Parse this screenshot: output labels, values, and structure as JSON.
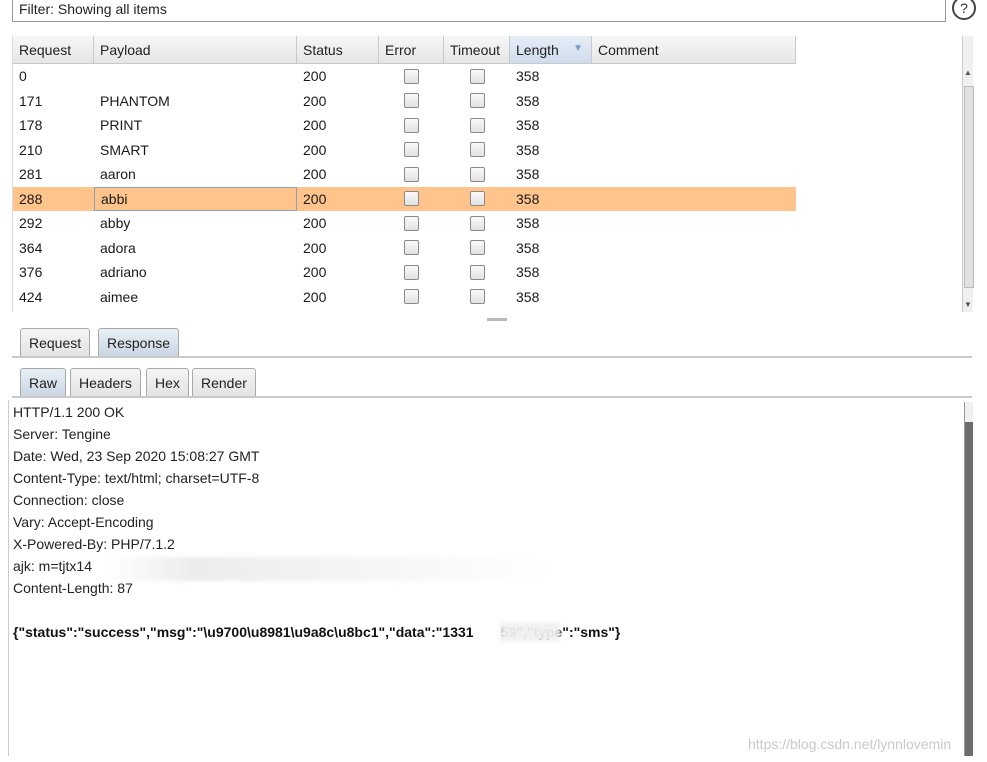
{
  "filter": {
    "text": "Filter: Showing all items",
    "help_label": "?"
  },
  "table": {
    "columns": [
      "Request",
      "Payload",
      "Status",
      "Error",
      "Timeout",
      "Length",
      "Comment"
    ],
    "rows": [
      {
        "request": "0",
        "payload": "",
        "status": "200",
        "error": false,
        "timeout": false,
        "length": "358",
        "comment": ""
      },
      {
        "request": "171",
        "payload": "PHANTOM",
        "status": "200",
        "error": false,
        "timeout": false,
        "length": "358",
        "comment": ""
      },
      {
        "request": "178",
        "payload": "PRINT",
        "status": "200",
        "error": false,
        "timeout": false,
        "length": "358",
        "comment": ""
      },
      {
        "request": "210",
        "payload": "SMART",
        "status": "200",
        "error": false,
        "timeout": false,
        "length": "358",
        "comment": ""
      },
      {
        "request": "281",
        "payload": "aaron",
        "status": "200",
        "error": false,
        "timeout": false,
        "length": "358",
        "comment": ""
      },
      {
        "request": "288",
        "payload": "abbi",
        "status": "200",
        "error": false,
        "timeout": false,
        "length": "358",
        "comment": "",
        "selected": true
      },
      {
        "request": "292",
        "payload": "abby",
        "status": "200",
        "error": false,
        "timeout": false,
        "length": "358",
        "comment": ""
      },
      {
        "request": "364",
        "payload": "adora",
        "status": "200",
        "error": false,
        "timeout": false,
        "length": "358",
        "comment": ""
      },
      {
        "request": "376",
        "payload": "adriano",
        "status": "200",
        "error": false,
        "timeout": false,
        "length": "358",
        "comment": ""
      },
      {
        "request": "424",
        "payload": "aimee",
        "status": "200",
        "error": false,
        "timeout": false,
        "length": "358",
        "comment": ""
      }
    ],
    "sorted_column": "Length",
    "selection_color": "#ffc38c"
  },
  "tabs_top": [
    "Request",
    "Response"
  ],
  "tabs_top_active": "Response",
  "tabs_view": [
    "Raw",
    "Headers",
    "Hex",
    "Render"
  ],
  "tabs_view_active": "Raw",
  "response": {
    "lines": [
      "HTTP/1.1 200 OK",
      "Server: Tengine",
      "Date: Wed, 23 Sep 2020 15:08:27 GMT",
      "Content-Type: text/html; charset=UTF-8",
      "Connection: close",
      "Vary: Accept-Encoding",
      "X-Powered-By: PHP/7.1.2",
      "ajk: m=tjtx14",
      "Content-Length: 87"
    ],
    "json": "{\"status\":\"success\",\"msg\":\"\\u9700\\u8981\\u9a8c\\u8bc1\",\"data\":\"1331       59\",\"type\":\"sms\"}"
  },
  "watermark": "https://blog.csdn.net/lynnlovemin"
}
